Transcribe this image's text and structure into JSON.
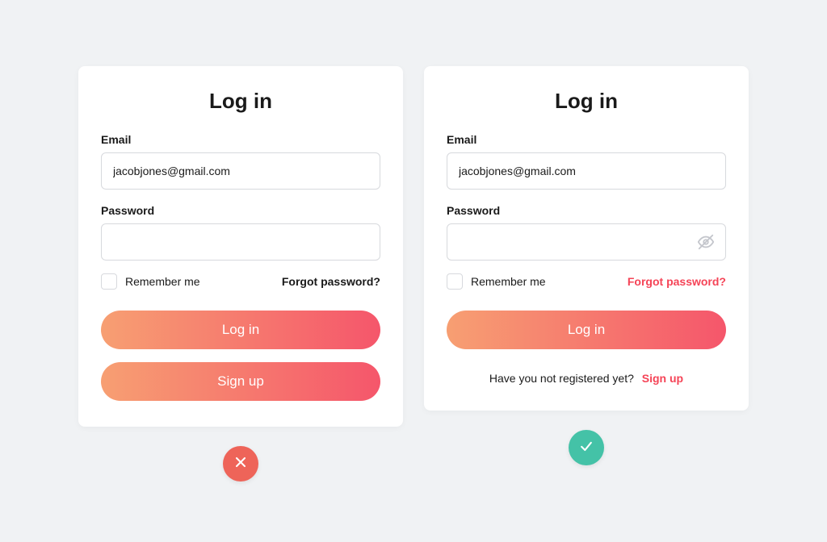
{
  "left": {
    "title": "Log in",
    "email_label": "Email",
    "email_value": "jacobjones@gmail.com",
    "password_label": "Password",
    "remember_label": "Remember me",
    "forgot_label": "Forgot password?",
    "login_button": "Log in",
    "signup_button": "Sign up"
  },
  "right": {
    "title": "Log in",
    "email_label": "Email",
    "email_value": "jacobjones@gmail.com",
    "password_label": "Password",
    "remember_label": "Remember me",
    "forgot_label": "Forgot password?",
    "login_button": "Log in",
    "signup_prompt": "Have you not registered yet?",
    "signup_link": "Sign up"
  },
  "icons": {
    "eye_off": "eye-off-icon",
    "cross": "cross-icon",
    "check": "check-icon"
  },
  "colors": {
    "accent": "#f54457",
    "gradient_start": "#f79f72",
    "gradient_end": "#f5566b",
    "bad_badge": "#ee6459",
    "good_badge": "#44c2a7"
  }
}
